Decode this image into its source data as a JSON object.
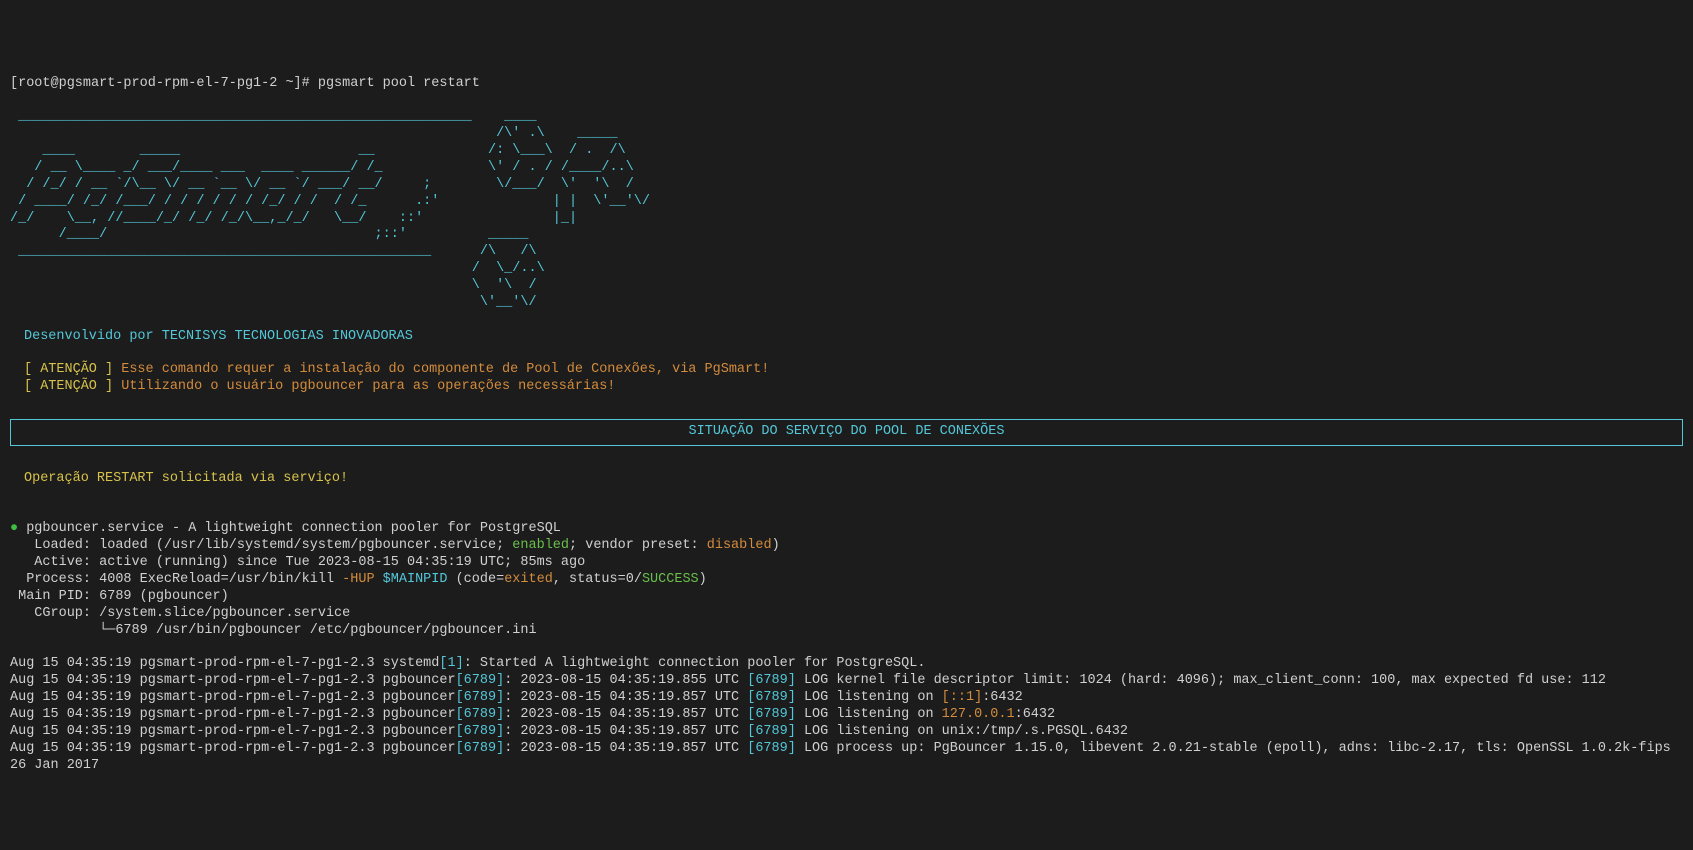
{
  "prompt": {
    "userhost": "[root@pgsmart-prod-rpm-el-7-pg1-2 ~]# ",
    "cmd": "pgsmart pool restart"
  },
  "ascii": " ________________________________________________________    ____\n                                                            /\\' .\\    _____\n    ____        _____                      __              /: \\___\\  / .  /\\\n   / __ \\____ _/ ___/____ ___  ____ ______/ /_             \\' / . / /____/..\\\n  / /_/ / __ `/\\__ \\/ __ `__ \\/ __ `/ ___/ __/     ;        \\/___/  \\'  '\\  /\n / ____/ /_/ /___/ / / / / / / /_/ / /  / /_      .:'              | |  \\'__'\\/\n/_/    \\__, //____/_/ /_/ /_/\\__,_/_/   \\__/    ::'                |_|\n      /____/                                 ;::'          _____\n ___________________________________________________      /\\   /\\\n                                                         /  \\_/..\\\n                                                         \\  '\\  /\n                                                          \\'__'\\/",
  "dev_by": "Desenvolvido por TECNISYS TECNOLOGIAS INOVADORAS",
  "warn": {
    "tag": "[ ATENÇÃO ] ",
    "l1": "Esse comando requer a instalação do componente de Pool de Conexões, via PgSmart!",
    "l2": "Utilizando o usuário pgbouncer para as operações necessárias!"
  },
  "status_title": "SITUAÇÃO DO SERVIÇO DO POOL DE CONEXÕES",
  "op_msg": "Operação RESTART solicitada via serviço!",
  "svc": {
    "bullet": "● ",
    "head": "pgbouncer.service - A lightweight connection pooler for PostgreSQL",
    "loaded_a": "   Loaded: loaded (/usr/lib/systemd/system/pgbouncer.service; ",
    "loaded_enabled": "enabled",
    "loaded_b": "; vendor preset: ",
    "loaded_disabled": "disabled",
    "loaded_c": ")",
    "active": "   Active: active (running) since Tue 2023-08-15 04:35:19 UTC; 85ms ago",
    "process_a": "  Process: 4008 ExecReload=/usr/bin/kill ",
    "process_hup": "-HUP",
    "process_b": " ",
    "process_mainpid": "$MAINPID",
    "process_c": " (code=",
    "process_exited": "exited",
    "process_d": ", status=0/",
    "process_success": "SUCCESS",
    "process_e": ")",
    "mainpid": " Main PID: 6789 (pgbouncer)",
    "cgroup1": "   CGroup: /system.slice/pgbouncer.service",
    "cgroup2": "           └─6789 /usr/bin/pgbouncer /etc/pgbouncer/pgbouncer.ini"
  },
  "logs": {
    "l1a": "Aug 15 04:35:19 pgsmart-prod-rpm-el-7-pg1-2.3 systemd",
    "l1pid": "[1]",
    "l1b": ": Started A lightweight connection pooler for PostgreSQL.",
    "l2a": "Aug 15 04:35:19 pgsmart-prod-rpm-el-7-pg1-2.3 pgbouncer",
    "l2pid": "[6789]",
    "l2b": ": 2023-08-15 04:35:19.855 UTC ",
    "l2pid2": "[6789]",
    "l2c": " LOG kernel file descriptor limit: 1024 (hard: 4096); max_client_conn: 100, max expected fd use: 112",
    "l3a": "Aug 15 04:35:19 pgsmart-prod-rpm-el-7-pg1-2.3 pgbouncer",
    "l3pid": "[6789]",
    "l3b": ": 2023-08-15 04:35:19.857 UTC ",
    "l3pid2": "[6789]",
    "l3c": " LOG listening on ",
    "l3addr": "[::1]",
    "l3d": ":6432",
    "l4a": "Aug 15 04:35:19 pgsmart-prod-rpm-el-7-pg1-2.3 pgbouncer",
    "l4pid": "[6789]",
    "l4b": ": 2023-08-15 04:35:19.857 UTC ",
    "l4pid2": "[6789]",
    "l4c": " LOG listening on ",
    "l4addr": "127.0.0.1",
    "l4d": ":6432",
    "l5a": "Aug 15 04:35:19 pgsmart-prod-rpm-el-7-pg1-2.3 pgbouncer",
    "l5pid": "[6789]",
    "l5b": ": 2023-08-15 04:35:19.857 UTC ",
    "l5pid2": "[6789]",
    "l5c": " LOG listening on unix:/tmp/.s.PGSQL.6432",
    "l6a": "Aug 15 04:35:19 pgsmart-prod-rpm-el-7-pg1-2.3 pgbouncer",
    "l6pid": "[6789]",
    "l6b": ": 2023-08-15 04:35:19.857 UTC ",
    "l6pid2": "[6789]",
    "l6c": " LOG process up: PgBouncer 1.15.0, libevent 2.0.21-stable (epoll), adns: libc-2.17, tls: OpenSSL 1.0.2k-fips  26 Jan 2017"
  }
}
